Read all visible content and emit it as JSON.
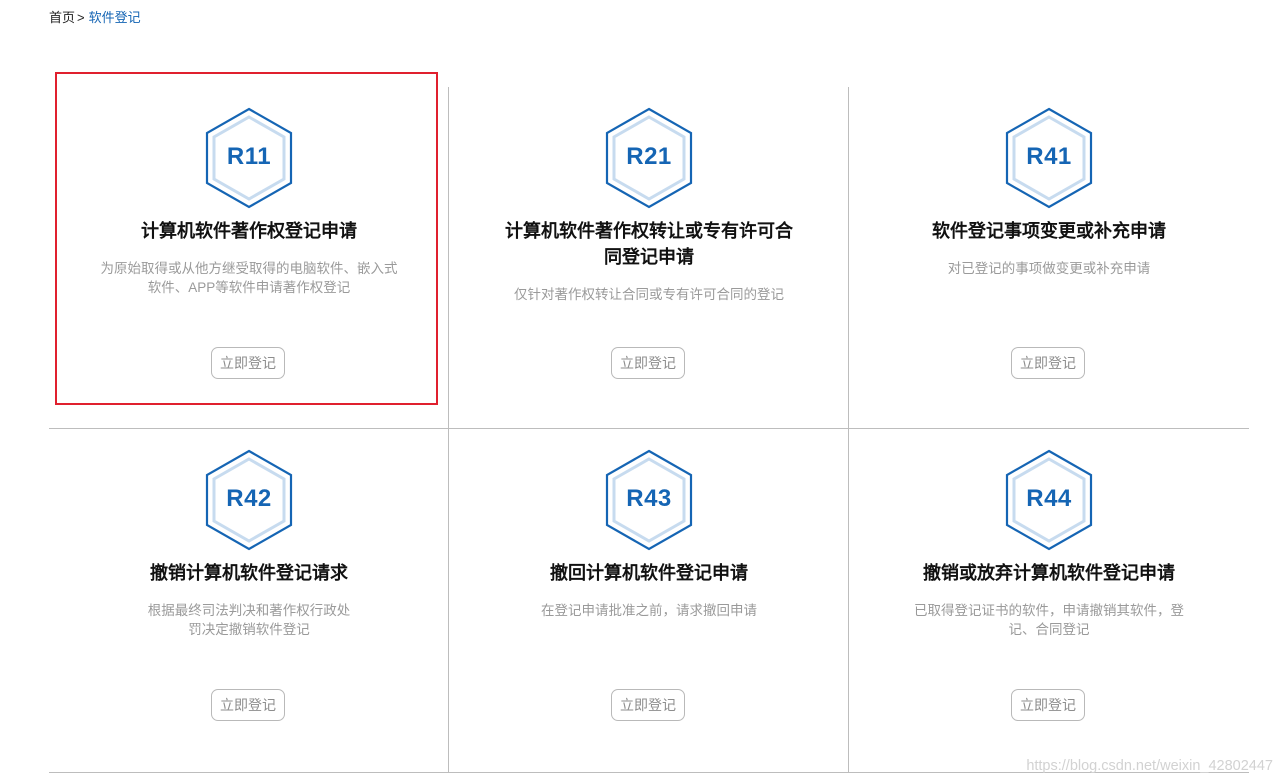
{
  "breadcrumb": {
    "home": "首页",
    "separator": ">",
    "current": "软件登记"
  },
  "colors": {
    "accent": "#1565b4",
    "highlight_border": "#e0202e",
    "hex_inner": "#c7dbef"
  },
  "cards": [
    {
      "code": "R11",
      "title": "计算机软件著作权登记申请",
      "desc": "为原始取得或从他方继受取得的电脑软件、嵌入式软件、APP等软件申请著作权登记",
      "button": "立即登记",
      "icon": "hexagon-badge-icon",
      "highlighted": true
    },
    {
      "code": "R21",
      "title": "计算机软件著作权转让或专有许可合同登记申请",
      "desc": "仅针对著作权转让合同或专有许可合同的登记",
      "button": "立即登记",
      "icon": "hexagon-badge-icon"
    },
    {
      "code": "R41",
      "title": "软件登记事项变更或补充申请",
      "desc": "对已登记的事项做变更或补充申请",
      "button": "立即登记",
      "icon": "hexagon-badge-icon"
    },
    {
      "code": "R42",
      "title": "撤销计算机软件登记请求",
      "desc": "根据最终司法判决和著作权行政处罚决定撤销软件登记",
      "button": "立即登记",
      "icon": "hexagon-badge-icon"
    },
    {
      "code": "R43",
      "title": "撤回计算机软件登记申请",
      "desc": "在登记申请批准之前，请求撤回申请",
      "button": "立即登记",
      "icon": "hexagon-badge-icon"
    },
    {
      "code": "R44",
      "title": "撤销或放弃计算机软件登记申请",
      "desc": "已取得登记证书的软件，申请撤销其软件，登记、合同登记",
      "button": "立即登记",
      "icon": "hexagon-badge-icon"
    }
  ],
  "watermark": "https://blog.csdn.net/weixin_42802447"
}
